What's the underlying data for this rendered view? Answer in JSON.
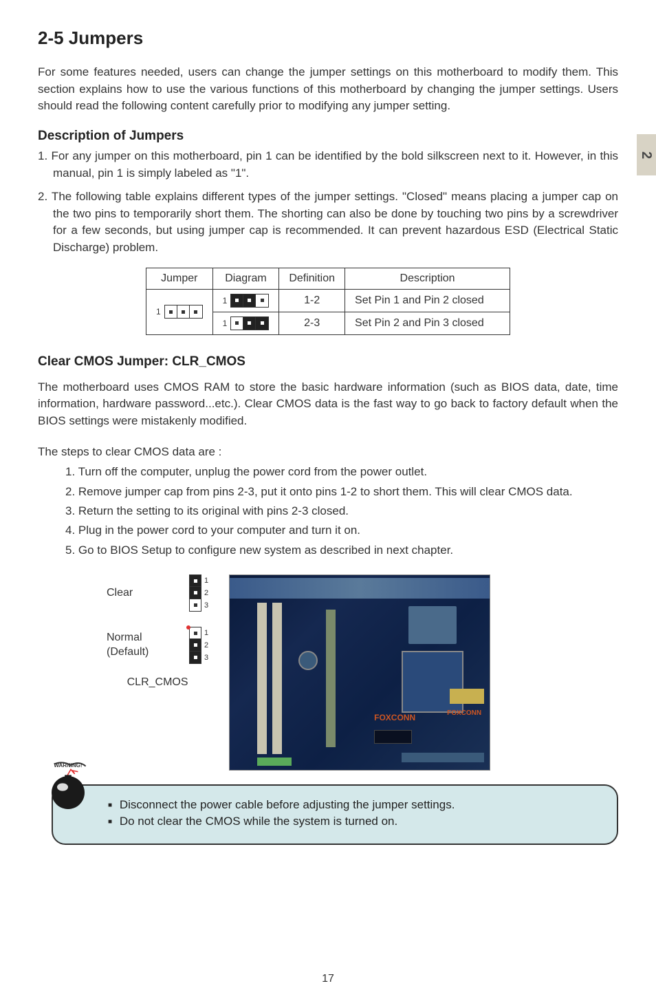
{
  "side_tab": "2",
  "section_title": "2-5 Jumpers",
  "intro": "For some features needed, users can change the jumper settings on this motherboard to modify them. This section explains how to use the various functions of this motherboard by changing the jumper settings. Users should read the following content carefully prior to modifying any jumper setting.",
  "desc_head": "Description of Jumpers",
  "desc_items": [
    "1. For any jumper on this motherboard, pin 1 can be identified by the bold silkscreen next to it. However, in this manual, pin 1 is simply labeled as \"1\".",
    "2. The following table explains different types of the jumper settings. \"Closed\" means placing a jumper cap on the two pins to temporarily short them. The shorting can also be done by touching two pins by a screwdriver for a few seconds, but using jumper cap is recommended. It can prevent hazardous ESD (Electrical Static Discharge) problem."
  ],
  "table": {
    "headers": [
      "Jumper",
      "Diagram",
      "Definition",
      "Description"
    ],
    "rows": [
      {
        "definition": "1-2",
        "description": "Set Pin 1 and Pin 2 closed"
      },
      {
        "definition": "2-3",
        "description": "Set Pin 2 and Pin 3 closed"
      }
    ]
  },
  "clear_head": "Clear CMOS Jumper: CLR_CMOS",
  "clear_p1": "The motherboard uses CMOS RAM to store the basic hardware information (such as BIOS data, date, time information, hardware password...etc.). Clear CMOS data is the fast way to go back to factory default when the BIOS settings were mistakenly modified.",
  "clear_p2": "The steps to clear CMOS data are :",
  "steps": [
    "1. Turn off the computer, unplug the power cord from the power outlet.",
    "2. Remove jumper cap from pins 2-3, put it onto pins 1-2 to short them. This will clear CMOS data.",
    "3. Return the setting to its original with pins 2-3 closed.",
    "4. Plug in the power cord to your computer and turn it on.",
    "5. Go to BIOS Setup to configure new system as described in next chapter."
  ],
  "pin_config": {
    "clear": "Clear",
    "normal": "Normal",
    "default": "(Default)",
    "label": "CLR_CMOS",
    "nums": [
      "1",
      "2",
      "3"
    ]
  },
  "board_brand": "FOXCONN",
  "warning_label": "WARNING!",
  "warnings": [
    "Disconnect the power cable before adjusting the jumper settings.",
    "Do not clear the CMOS while the system is turned on."
  ],
  "page_num": "17"
}
